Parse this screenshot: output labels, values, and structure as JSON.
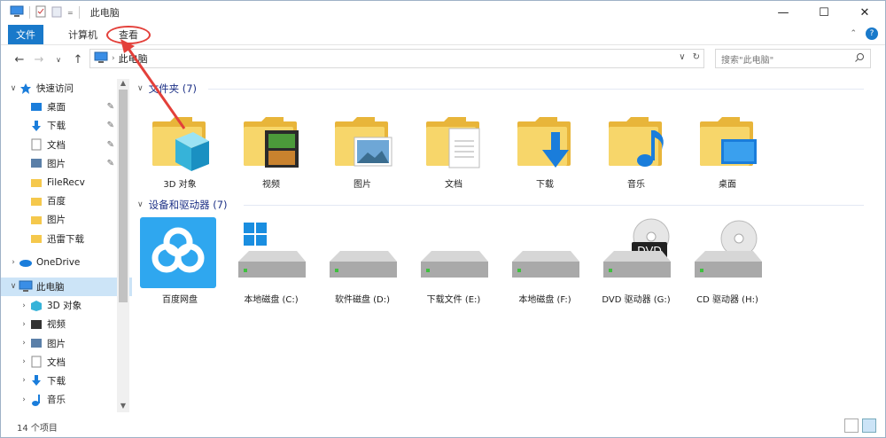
{
  "window": {
    "title": "此电脑",
    "controls": {
      "minimize": "—",
      "maximize": "☐",
      "close": "✕"
    }
  },
  "ribbon": {
    "file_tab": "文件",
    "tabs": [
      "计算机",
      "查看"
    ],
    "help": "?"
  },
  "address": {
    "crumb": "此电脑",
    "search_placeholder": "搜索\"此电脑\""
  },
  "nav": {
    "items": [
      {
        "label": "快速访问",
        "icon": "star-icon",
        "chev": "∨",
        "indent": 0
      },
      {
        "label": "桌面",
        "icon": "desktop-icon",
        "pin": true,
        "indent": 1
      },
      {
        "label": "下载",
        "icon": "download-icon",
        "pin": true,
        "indent": 1
      },
      {
        "label": "文档",
        "icon": "document-icon",
        "pin": true,
        "indent": 1
      },
      {
        "label": "图片",
        "icon": "picture-icon",
        "pin": true,
        "indent": 1
      },
      {
        "label": "FileRecv",
        "icon": "folder-icon",
        "indent": 1
      },
      {
        "label": "百度",
        "icon": "folder-icon",
        "indent": 1
      },
      {
        "label": "图片",
        "icon": "folder-icon",
        "indent": 1
      },
      {
        "label": "迅雷下载",
        "icon": "folder-icon",
        "indent": 1
      },
      {
        "label": "",
        "icon": "",
        "indent": 0,
        "spacer": true
      },
      {
        "label": "OneDrive",
        "icon": "cloud-icon",
        "chev": "›",
        "indent": 0
      },
      {
        "label": "",
        "icon": "",
        "indent": 0,
        "spacer": true
      },
      {
        "label": "此电脑",
        "icon": "computer-icon",
        "chev": "∨",
        "indent": 0,
        "selected": true
      },
      {
        "label": "3D 对象",
        "icon": "cube-icon",
        "chev": "›",
        "indent": 1
      },
      {
        "label": "视频",
        "icon": "video-icon",
        "chev": "›",
        "indent": 1
      },
      {
        "label": "图片",
        "icon": "picture-icon",
        "chev": "›",
        "indent": 1
      },
      {
        "label": "文档",
        "icon": "document-icon",
        "chev": "›",
        "indent": 1
      },
      {
        "label": "下载",
        "icon": "download-icon",
        "chev": "›",
        "indent": 1
      },
      {
        "label": "音乐",
        "icon": "music-icon",
        "chev": "›",
        "indent": 1
      }
    ]
  },
  "folders": {
    "header": "文件夹 (7)",
    "items": [
      {
        "label": "3D 对象",
        "icon": "cube-folder-icon"
      },
      {
        "label": "视频",
        "icon": "video-folder-icon"
      },
      {
        "label": "图片",
        "icon": "picture-folder-icon"
      },
      {
        "label": "文档",
        "icon": "document-folder-icon"
      },
      {
        "label": "下载",
        "icon": "download-folder-icon"
      },
      {
        "label": "音乐",
        "icon": "music-folder-icon"
      },
      {
        "label": "桌面",
        "icon": "desktop-folder-icon"
      }
    ]
  },
  "devices": {
    "header": "设备和驱动器 (7)",
    "items": [
      {
        "label": "百度网盘",
        "icon": "baidu-netdisk-icon"
      },
      {
        "label": "本地磁盘 (C:)",
        "icon": "system-drive-icon"
      },
      {
        "label": "软件磁盘 (D:)",
        "icon": "drive-icon"
      },
      {
        "label": "下载文件 (E:)",
        "icon": "drive-icon"
      },
      {
        "label": "本地磁盘 (F:)",
        "icon": "drive-icon"
      },
      {
        "label": "DVD 驱动器 (G:)",
        "icon": "dvd-drive-icon",
        "badge": "DVD"
      },
      {
        "label": "CD 驱动器 (H:)",
        "icon": "cd-drive-icon"
      }
    ]
  },
  "status": {
    "count": "14 个项目"
  },
  "colors": {
    "accent": "#1979ca",
    "annotation": "#e3403a",
    "folder": "#f5c84c"
  }
}
